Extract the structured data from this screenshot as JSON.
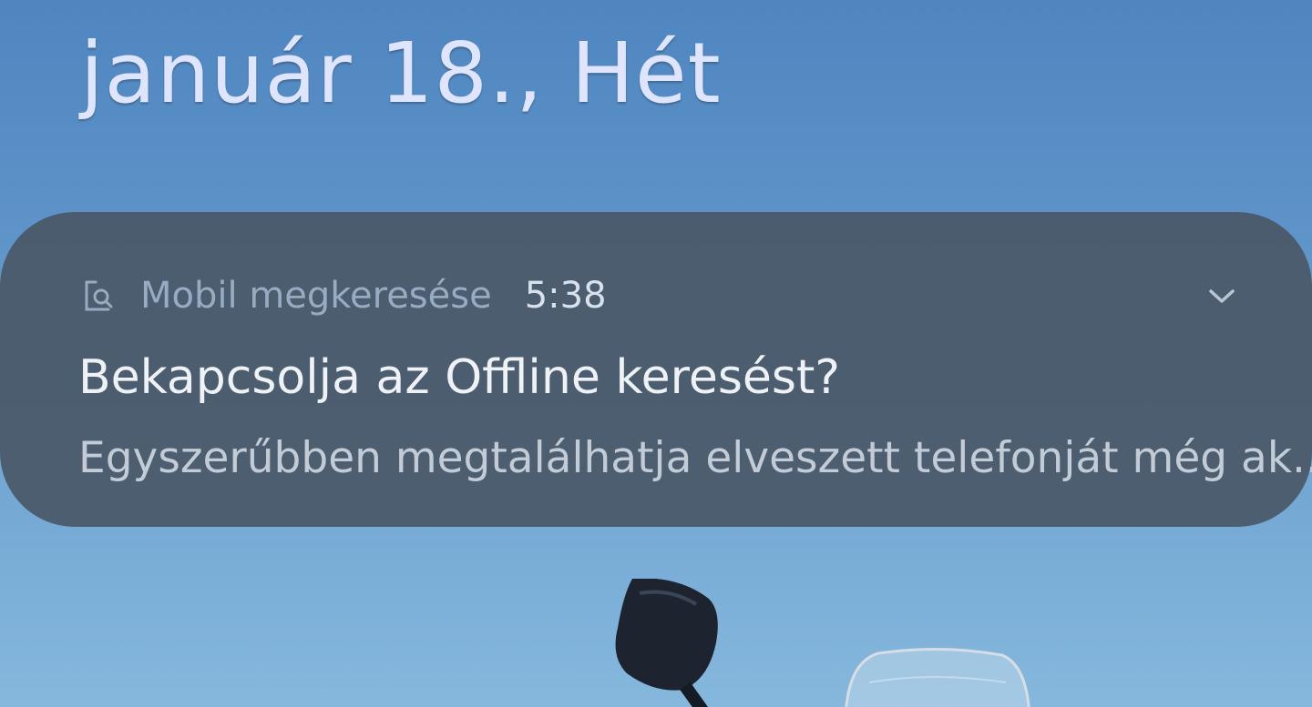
{
  "lockscreen": {
    "date": "január 18., Hét"
  },
  "notification": {
    "app_icon": "find-my-mobile-icon",
    "app_name": "Mobil megkeresése",
    "time": "5:38",
    "title": "Bekapcsolja az Offline keresést?",
    "body": "Egyszerűbben megtalálhatja elveszett telefonját még ak..",
    "expand_icon": "chevron-down-icon"
  },
  "colors": {
    "sky_top": "#4f86c0",
    "sky_bottom": "#86b8dd",
    "notification_bg": "#4a5868",
    "date_text": "#dfe4ff"
  }
}
